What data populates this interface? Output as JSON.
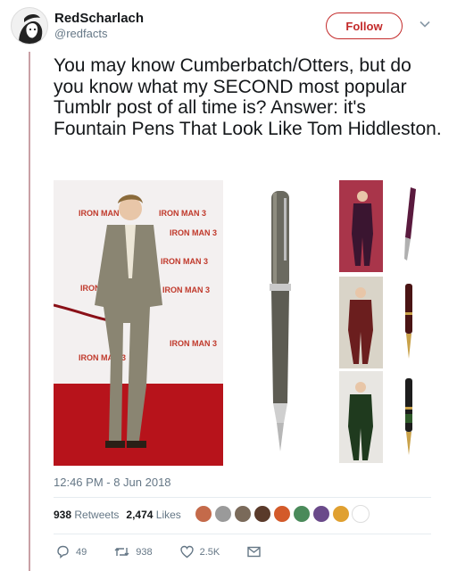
{
  "user": {
    "name": "RedScharlach",
    "handle": "@redfacts",
    "follow_label": "Follow"
  },
  "tweet": {
    "text": "You may know Cumberbatch/Otters, but do you know what my SECOND most popular Tumblr post of all time is? Answer: it's Fountain Pens That Look Like Tom Hiddleston.",
    "timestamp": "12:46 PM - 8 Jun 2018"
  },
  "stats": {
    "retweets_count": "938",
    "retweets_label": "Retweets",
    "likes_count": "2,474",
    "likes_label": "Likes"
  },
  "actions": {
    "replies": "49",
    "retweets": "938",
    "likes": "2.5K"
  },
  "media": {
    "backdrop_text": "IRON MAN 3"
  },
  "colors": {
    "accent": "#c32a2a",
    "muted": "#657786",
    "thread_line": "#c9a0a6"
  },
  "icons": [
    "chevron-down-icon",
    "reply-icon",
    "retweet-icon",
    "heart-icon",
    "message-icon"
  ]
}
